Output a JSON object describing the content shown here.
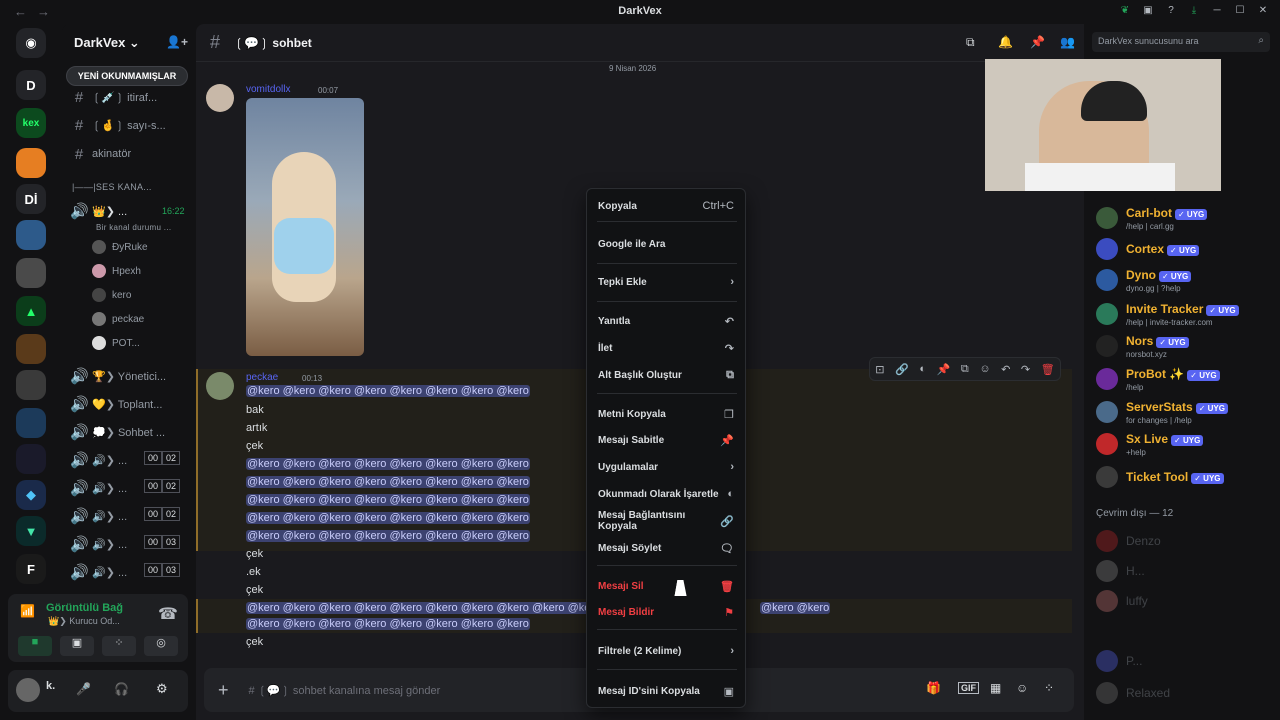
{
  "window": {
    "title": "DarkVex",
    "nav_back": "←",
    "nav_fwd": "→"
  },
  "servers": {
    "discord": "discord-logo",
    "items": [
      "D",
      "kex",
      "Dİ"
    ]
  },
  "guild": {
    "name": "DarkVex ⌄",
    "unread_pill": "YENİ OKUNMAMIŞLAR"
  },
  "channels": {
    "text": [
      {
        "hash": "#",
        "label": "❲💉❳ itiraf..."
      },
      {
        "hash": "#",
        "label": "❲🤞❳ sayı-s..."
      },
      {
        "hash": "#",
        "label": "akinatör"
      }
    ],
    "voice_category": "|——|SES KANA...",
    "active_voice": {
      "label": "👑❯ ...",
      "time": "16:22",
      "status": "Bir kanal durumu ..."
    },
    "voice_users": [
      "ÐyRuke",
      "Hpexh",
      "kero",
      "peckae",
      "POT..."
    ],
    "voice_channels": [
      {
        "label": "🏆❯ Yönetici..."
      },
      {
        "label": "💛❯ Toplant..."
      },
      {
        "label": "💭❯ Sohbet ..."
      },
      {
        "label": "🔊❯ ...",
        "a": "00",
        "b": "02"
      },
      {
        "label": "🔊❯ ...",
        "a": "00",
        "b": "02"
      },
      {
        "label": "🔊❯ ...",
        "a": "00",
        "b": "02"
      },
      {
        "label": "🔊❯ ...",
        "a": "00",
        "b": "03"
      },
      {
        "label": "🔊❯ ...",
        "a": "00",
        "b": "03"
      }
    ]
  },
  "voice_panel": {
    "status": "Görüntülü Bağ",
    "channel": "👑❯ Kurucu Od..."
  },
  "user_panel": {
    "name": "k."
  },
  "chat": {
    "channel": "❲💬❳ sohbet",
    "date_divider": "9 Nisan 2026",
    "msg1": {
      "author": "vomitdollx",
      "time": "00:07"
    },
    "msg2": {
      "author": "peckae",
      "time": "00:13"
    },
    "lines": {
      "m_row": "@kero @kero @kero @kero @kero @kero @kero @kero",
      "bak": "bak",
      "artik": "artık",
      "cek": "çek",
      "ek": ".ek",
      "long_row": "@kero @kero @kero @kero @kero @kero @kero @kero @kero @kero",
      "long_tail": "@kero @kero",
      "last_row": "@kero @kero @kero @kero @kero @kero @kero @kero"
    },
    "composer_placeholder": "# ❲💬❳ sohbet kanalına mesaj gönder",
    "search_placeholder": "DarkVex sunucusunu ara"
  },
  "context_menu": {
    "copy": "Kopyala",
    "copy_shortcut": "Ctrl+C",
    "google": "Google ile Ara",
    "react": "Tepki Ekle",
    "reply": "Yanıtla",
    "forward": "İlet",
    "thread": "Alt Başlık Oluştur",
    "copy_text": "Metni Kopyala",
    "pin": "Mesajı Sabitle",
    "apps": "Uygulamalar",
    "mark_unread": "Okunmadı Olarak İşaretle",
    "copy_link": "Mesaj Bağlantısını Kopyala",
    "speak": "Mesajı Söylet",
    "delete": "Mesajı Sil",
    "report": "Mesaj Bildir",
    "filter": "Filtrele (2 Kelime)",
    "copy_id": "Mesaj ID'sini Kopyala"
  },
  "members": {
    "bots": [
      {
        "name": "Carl-bot",
        "badge": "✓ UYG",
        "status": "/help | carl.gg",
        "color": "#f0b232"
      },
      {
        "name": "Cortex",
        "badge": "✓ UYG",
        "status": "",
        "color": "#f0b232"
      },
      {
        "name": "Dyno",
        "badge": "✓ UYG",
        "status": "dyno.gg | ?help",
        "color": "#f0b232"
      },
      {
        "name": "Invite Tracker",
        "badge": "✓ UYG",
        "status": "/help | invite-tracker.com",
        "color": "#f0b232"
      },
      {
        "name": "Nors",
        "badge": "✓ UYG",
        "status": "norsbot.xyz",
        "color": "#f0b232"
      },
      {
        "name": "ProBot ✨",
        "badge": "✓ UYG",
        "status": "/help",
        "color": "#f0b232"
      },
      {
        "name": "ServerStats",
        "badge": "✓ UYG",
        "status": "for changes | /help",
        "color": "#f0b232"
      },
      {
        "name": "Sx Live",
        "badge": "✓ UYG",
        "status": "+help",
        "color": "#f0b232"
      },
      {
        "name": "Ticket Tool",
        "badge": "✓ UYG",
        "status": "",
        "color": "#f0b232"
      }
    ],
    "offline_header": "Çevrim dışı — 12",
    "offline": [
      "Denzo",
      "H...",
      "luffy",
      "P...",
      "Relaxed"
    ]
  },
  "colors": {
    "danger": "#f23f43",
    "accent": "#5865f2",
    "bot_name": "#f0b232"
  }
}
